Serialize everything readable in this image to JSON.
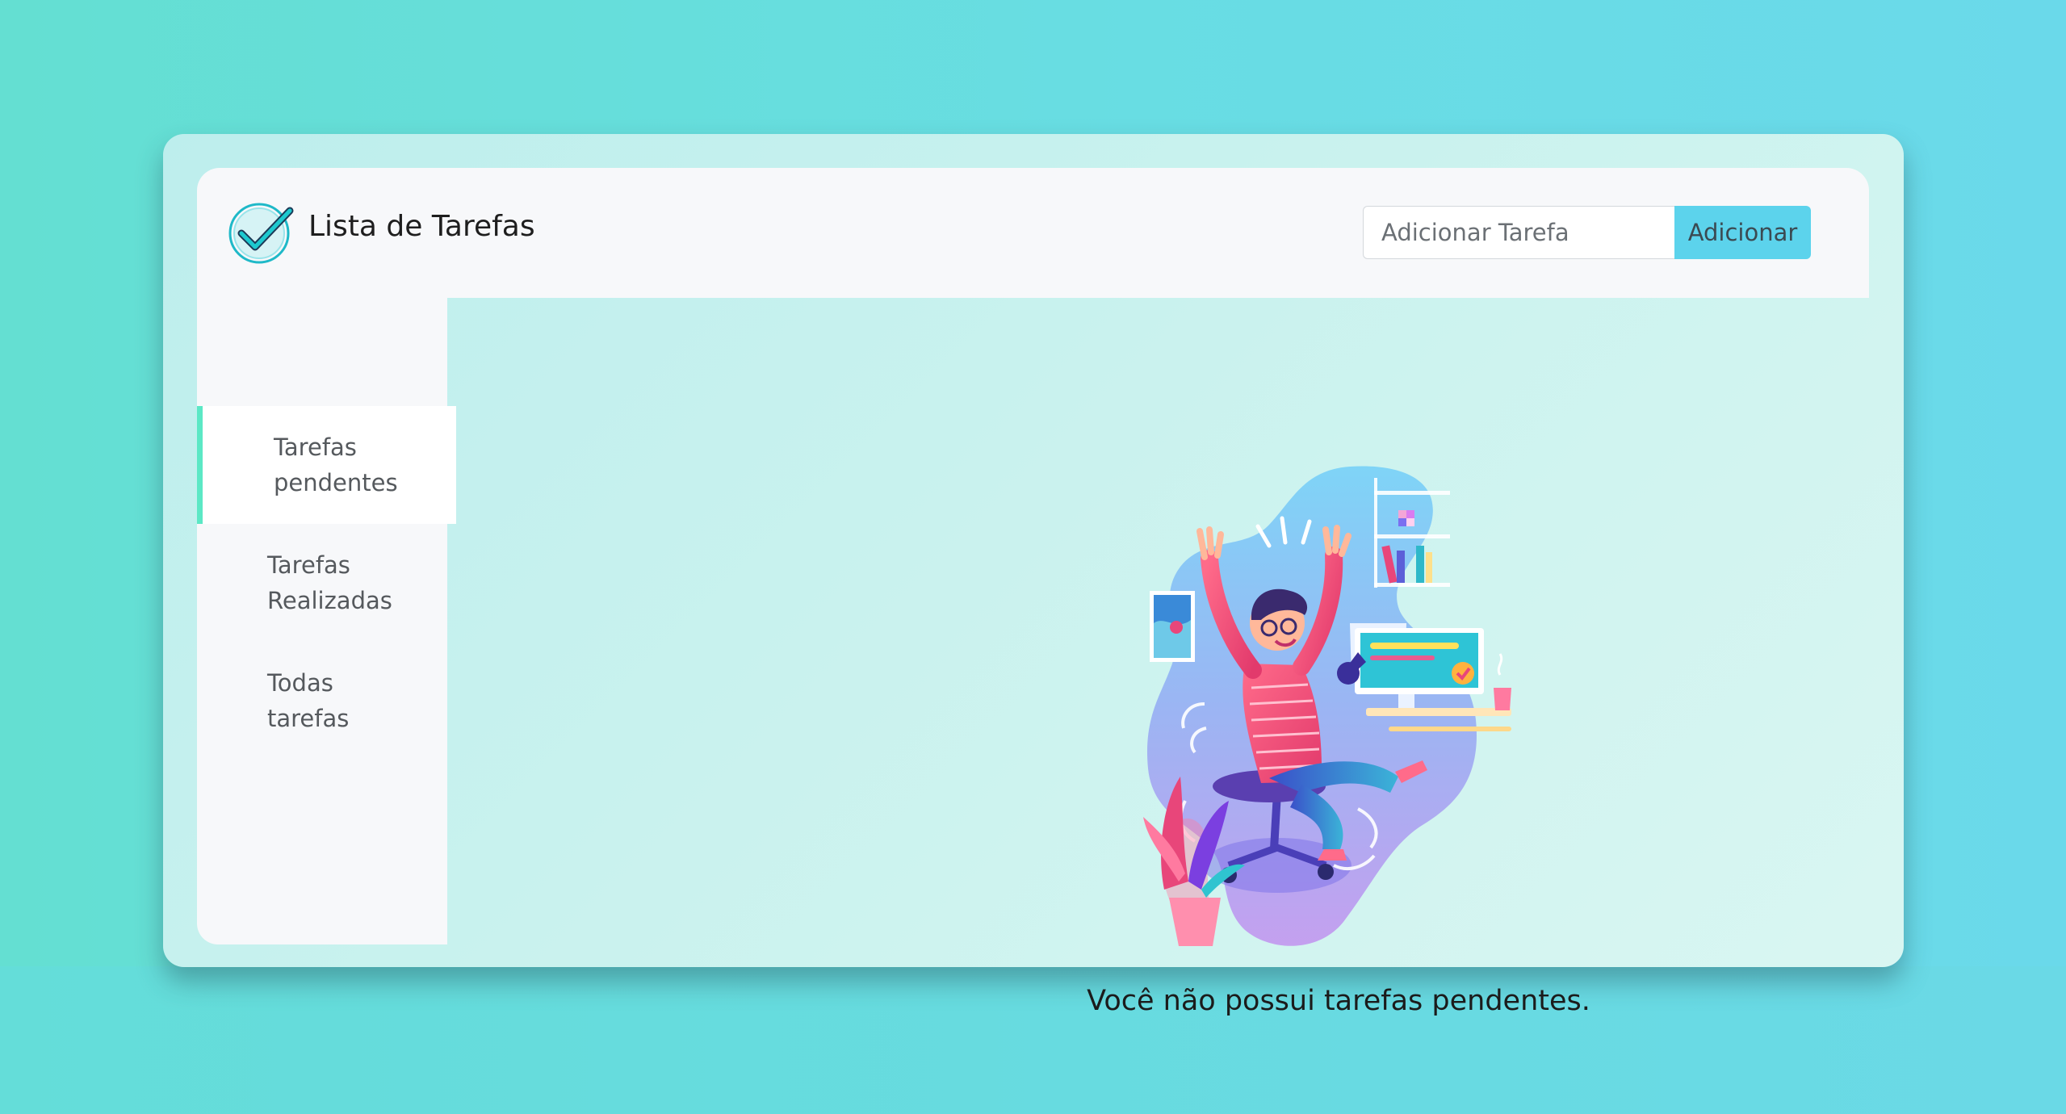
{
  "app": {
    "title": "Lista de Tarefas",
    "logo_icon": "check-circle-icon"
  },
  "add_task": {
    "placeholder": "Adicionar Tarefa",
    "value": "",
    "button_label": "Adicionar"
  },
  "sidebar": {
    "items": [
      {
        "line1": "Tarefas",
        "line2": "pendentes",
        "active": true
      },
      {
        "line1": "Tarefas",
        "line2": "Realizadas",
        "active": false
      },
      {
        "line1": "Todas",
        "line2": "tarefas",
        "active": false
      }
    ]
  },
  "main": {
    "illustration": "celebrating-person-at-desk-illustration",
    "empty_message": "Você não possui tarefas pendentes."
  },
  "colors": {
    "accent": "#5cd3ec",
    "active_indicator": "#5be8c5",
    "panel": "#f7f8fa"
  }
}
